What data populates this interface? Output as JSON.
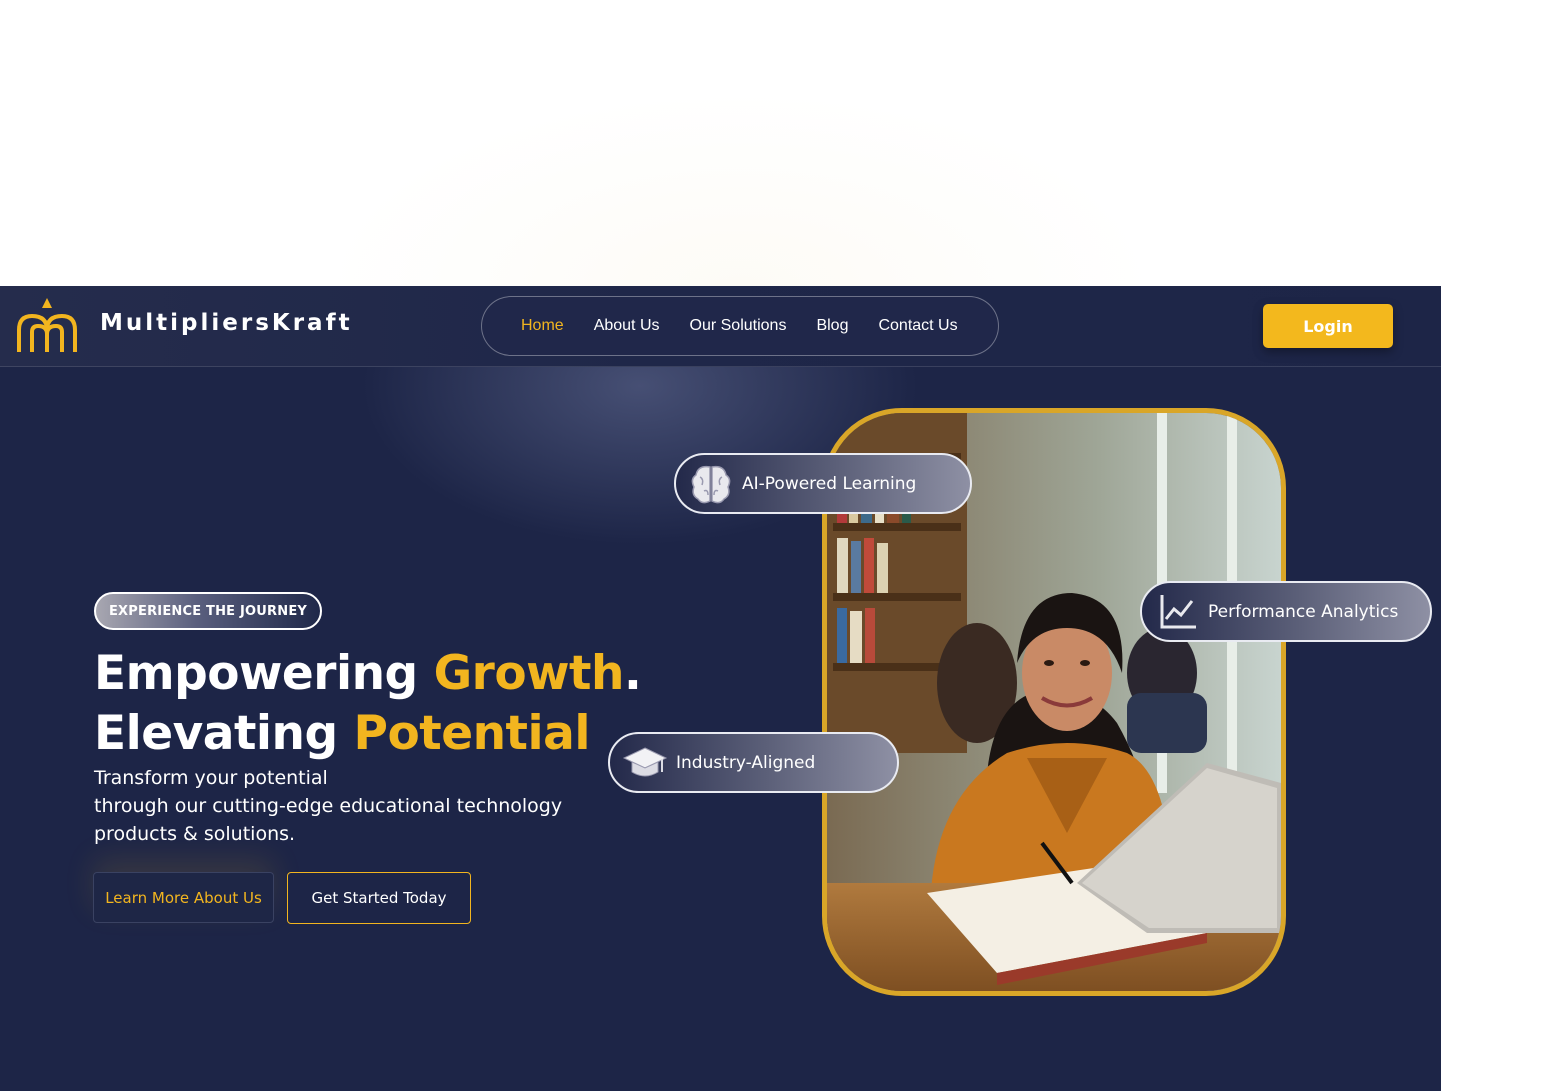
{
  "brand": {
    "name": "MultipliersKraft"
  },
  "nav": {
    "items": [
      {
        "label": "Home",
        "active": true
      },
      {
        "label": "About Us",
        "active": false
      },
      {
        "label": "Our Solutions",
        "active": false
      },
      {
        "label": "Blog",
        "active": false
      },
      {
        "label": "Contact Us",
        "active": false
      }
    ],
    "login_label": "Login"
  },
  "hero": {
    "badge": "EXPERIENCE THE JOURNEY",
    "headline_line1_white": "Empowering ",
    "headline_line1_gold": "Growth",
    "headline_line1_dot": ".",
    "headline_line2_white": "Elevating ",
    "headline_line2_gold": "Potential",
    "subtext_line1": "Transform your  potential",
    "subtext_line2": "through our cutting-edge educational technology",
    "subtext_line3": "products & solutions.",
    "btn_learn": "Learn More About Us",
    "btn_start": "Get Started Today"
  },
  "features": {
    "ai": {
      "label": "AI-Powered Learning",
      "icon": "brain-icon"
    },
    "perf": {
      "label": "Performance Analytics",
      "icon": "chart-icon"
    },
    "industry": {
      "label": "Industry-Aligned",
      "icon": "graduation-cap-icon"
    }
  },
  "colors": {
    "background": "#1d2547",
    "accent": "#f2b51f",
    "login_bg": "#f3b81d"
  }
}
